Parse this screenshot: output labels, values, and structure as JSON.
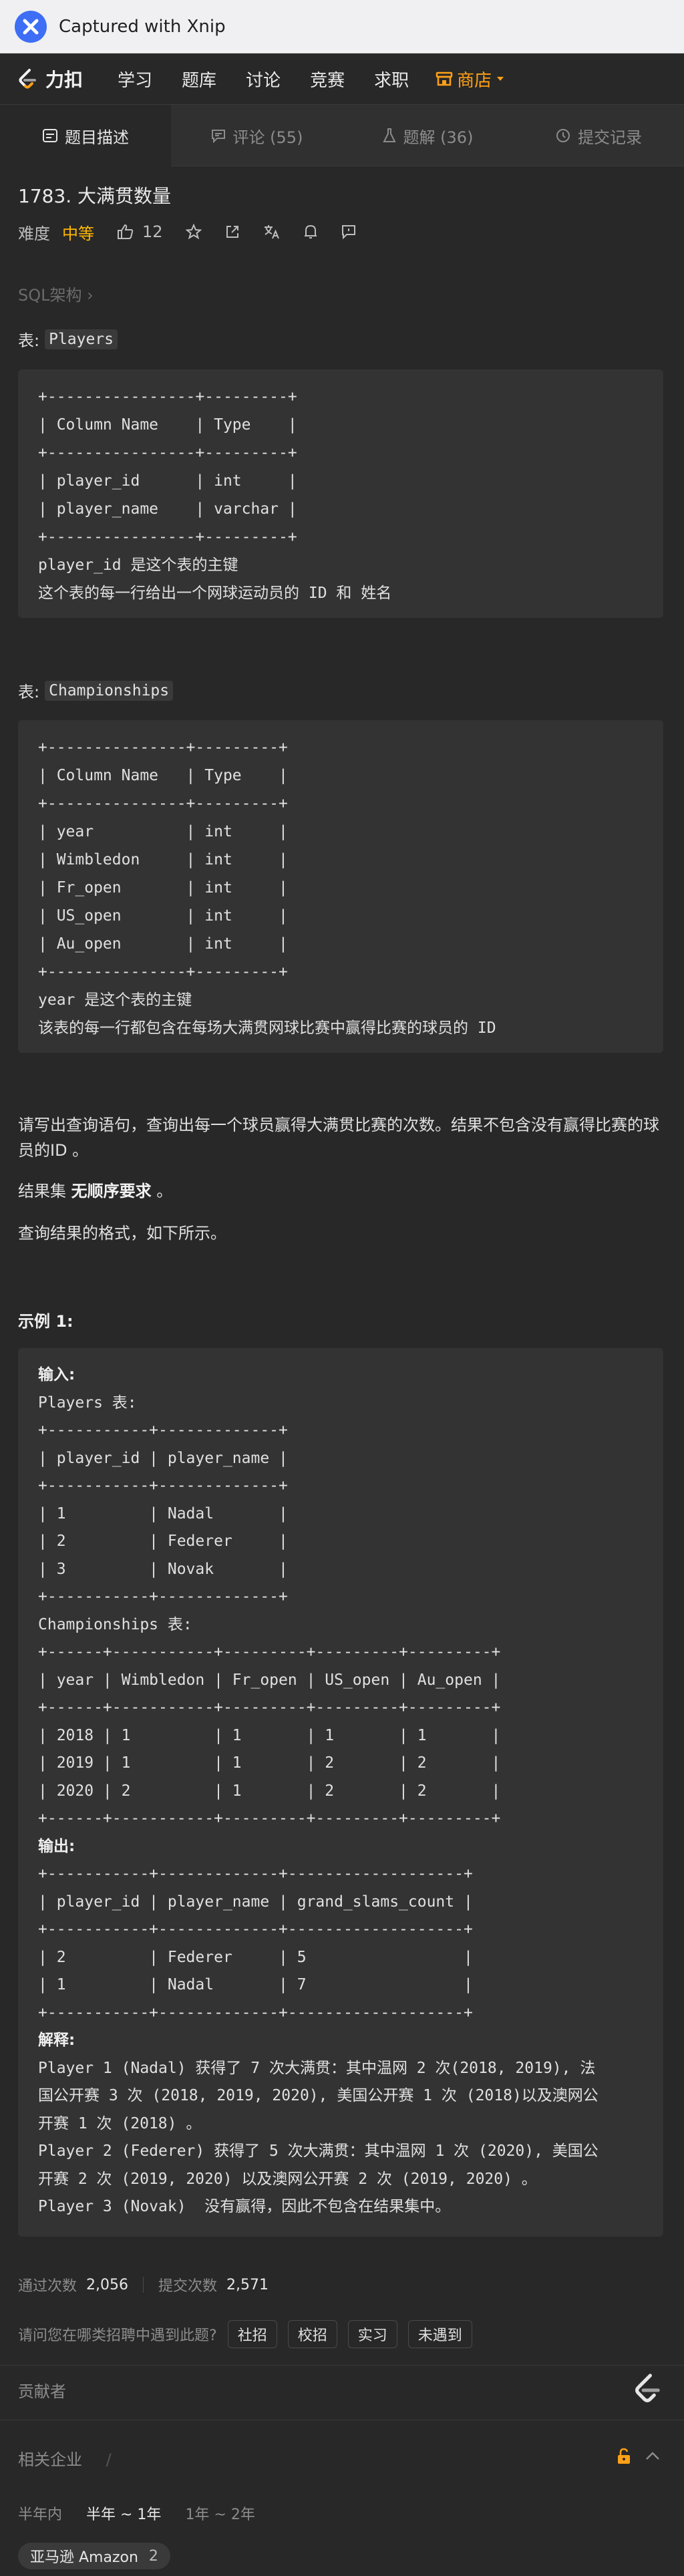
{
  "xnip": {
    "title": "Captured with Xnip"
  },
  "nav": {
    "brand": "力扣",
    "items": [
      "学习",
      "题库",
      "讨论",
      "竞赛",
      "求职"
    ],
    "store": "商店"
  },
  "tabs": [
    {
      "label": "题目描述"
    },
    {
      "label": "评论 (55)"
    },
    {
      "label": "题解 (36)"
    },
    {
      "label": "提交记录"
    }
  ],
  "problem": {
    "title": "1783. 大满贯数量",
    "difficulty_label": "难度",
    "difficulty": "中等",
    "likes": "12"
  },
  "breadcrumb": "SQL架构 ›",
  "table1": {
    "prefix": "表:",
    "name": "Players",
    "schema": "+----------------+---------+\n| Column Name    | Type    |\n+----------------+---------+\n| player_id      | int     |\n| player_name    | varchar |\n+----------------+---------+\nplayer_id 是这个表的主键\n这个表的每一行给出一个网球运动员的 ID 和 姓名"
  },
  "table2": {
    "prefix": "表:",
    "name": "Championships",
    "schema": "+---------------+---------+\n| Column Name   | Type    |\n+---------------+---------+\n| year          | int     |\n| Wimbledon     | int     |\n| Fr_open       | int     |\n| US_open       | int     |\n| Au_open       | int     |\n+---------------+---------+\nyear 是这个表的主键\n该表的每一行都包含在每场大满贯网球比赛中赢得比赛的球员的 ID"
  },
  "description": {
    "p1": "请写出查询语句，查询出每一个球员赢得大满贯比赛的次数。结果不包含没有赢得比赛的球员的ID 。",
    "p2_pre": "结果集 ",
    "p2_bold": "无顺序要求",
    "p2_post": " 。",
    "p3": "查询结果的格式，如下所示。"
  },
  "example": {
    "heading": "示例 1:",
    "input_label": "输入:",
    "input_body": "Players 表:\n+-----------+-------------+\n| player_id | player_name |\n+-----------+-------------+\n| 1         | Nadal       |\n| 2         | Federer     |\n| 3         | Novak       |\n+-----------+-------------+\nChampionships 表:\n+------+-----------+---------+---------+---------+\n| year | Wimbledon | Fr_open | US_open | Au_open |\n+------+-----------+---------+---------+---------+\n| 2018 | 1         | 1       | 1       | 1       |\n| 2019 | 1         | 1       | 2       | 2       |\n| 2020 | 2         | 1       | 2       | 2       |\n+------+-----------+---------+---------+---------+",
    "output_label": "输出:",
    "output_body": "+-----------+-------------+-------------------+\n| player_id | player_name | grand_slams_count |\n+-----------+-------------+-------------------+\n| 2         | Federer     | 5                 |\n| 1         | Nadal       | 7                 |\n+-----------+-------------+-------------------+",
    "explain_label": "解释:",
    "explain_body": "Player 1 (Nadal) 获得了 7 次大满贯：其中温网 2 次(2018, 2019), 法\n国公开赛 3 次 (2018, 2019, 2020), 美国公开赛 1 次 (2018)以及澳网公\n开赛 1 次 (2018) 。\nPlayer 2 (Federer) 获得了 5 次大满贯：其中温网 1 次 (2020), 美国公\n开赛 2 次 (2019, 2020) 以及澳网公开赛 2 次 (2019, 2020) 。\nPlayer 3 (Novak)  没有赢得，因此不包含在结果集中。"
  },
  "stats": {
    "accepted_label": "通过次数",
    "accepted": "2,056",
    "submitted_label": "提交次数",
    "submitted": "2,571"
  },
  "hiring": {
    "question": "请问您在哪类招聘中遇到此题?",
    "options": [
      "社招",
      "校招",
      "实习",
      "未遇到"
    ]
  },
  "contributors_label": "贡献者",
  "companies": {
    "label": "相关企业",
    "slash": "/",
    "periods": [
      "半年内",
      "半年 ~ 1年",
      "1年 ~ 2年"
    ],
    "tag_name": "亚马逊 Amazon",
    "tag_count": "2"
  },
  "colors": {
    "accent": "#ffa116",
    "medium": "#ffb800",
    "background": "#282828"
  },
  "icons": [
    "xnip-logo-icon",
    "leetcode-logo-icon",
    "store-icon",
    "caret-down-icon",
    "description-icon",
    "comment-icon",
    "flask-icon",
    "clock-icon",
    "thumbs-up-icon",
    "star-icon",
    "share-icon",
    "translate-icon",
    "bell-icon",
    "feedback-icon",
    "unlock-icon",
    "chevron-up-icon"
  ]
}
